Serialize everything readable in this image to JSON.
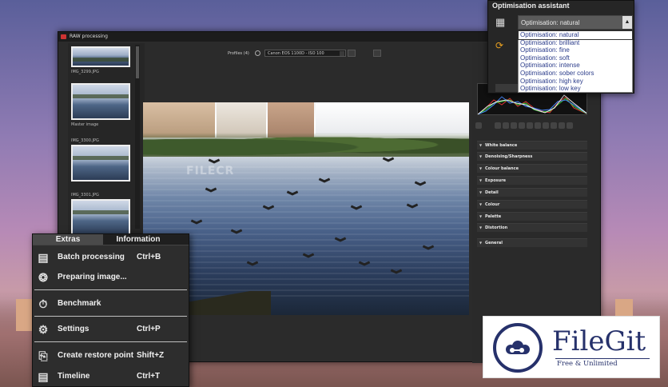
{
  "window": {
    "title": "RAW processing"
  },
  "thumbnails": [
    {
      "name": "IMG_3299.JPG"
    },
    {
      "name": "Master image"
    },
    {
      "name": "IMG_3300.JPG"
    },
    {
      "name": "IMG_3301.JPG"
    }
  ],
  "toolbar": {
    "profiles_label": "Profiles (4)",
    "profile_value": "Canon EOS 1100D - ISO 100"
  },
  "watermark": "FILECR",
  "adjustments": [
    "White balance",
    "Denoising/Sharpness",
    "Colour balance",
    "Exposure",
    "Detail",
    "Colour",
    "Palette",
    "Distortion",
    "General"
  ],
  "extras_menu": {
    "tabs": [
      "Extras",
      "Information"
    ],
    "items": [
      {
        "label": "Batch processing",
        "shortcut": "Ctrl+B",
        "icon": "batch-icon"
      },
      {
        "label": "Preparing image...",
        "shortcut": "",
        "icon": "film-reel-icon"
      },
      {
        "label": "Benchmark",
        "shortcut": "",
        "icon": "stopwatch-icon"
      },
      {
        "label": "Settings",
        "shortcut": "Ctrl+P",
        "icon": "gears-icon"
      },
      {
        "label": "Create restore point",
        "shortcut": "Shift+Z",
        "icon": "restore-icon"
      },
      {
        "label": "Timeline",
        "shortcut": "Ctrl+T",
        "icon": "timeline-icon"
      }
    ]
  },
  "optimisation": {
    "title": "Optimisation assistant",
    "selected": "Optimisation: natural",
    "options": [
      "Optimisation: natural",
      "Optimisation: brilliant",
      "Optimisation: fine",
      "Optimisation: soft",
      "Optimisation: intense",
      "Optimisation: sober colors",
      "Optimisation: high key",
      "Optimisation: low key"
    ]
  },
  "badge": {
    "name": "FileGit",
    "tagline": "Free & Unlimited"
  },
  "colors": {
    "menu_bg": "#2d2d2d",
    "option_text": "#2b3c8a",
    "brand": "#26316b"
  }
}
